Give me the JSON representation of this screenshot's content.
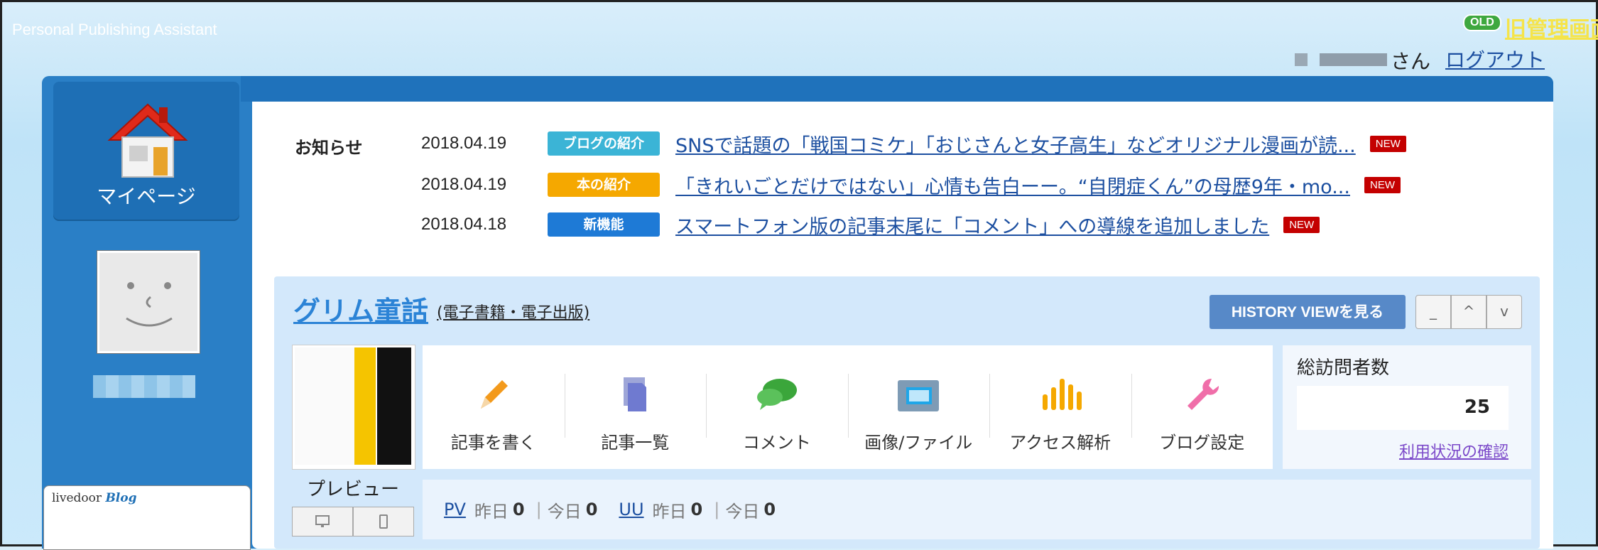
{
  "header": {
    "app_title": "Personal Publishing Assistant",
    "old_badge": "OLD",
    "old_admin_link": "旧管理画面",
    "user_suffix": "さん",
    "logout": "ログアウト"
  },
  "sidebar": {
    "mypage_label": "マイページ",
    "widget_logo": "livedoor",
    "widget_logo_accent": "Blog"
  },
  "news": {
    "heading": "お知らせ",
    "items": [
      {
        "date": "2018.04.19",
        "tag": "ブログの紹介",
        "tag_color": "#3bb4d6",
        "title": "SNSで話題の「戦国コミケ」「おじさんと女子高生」などオリジナル漫画が読...",
        "badge": "NEW"
      },
      {
        "date": "2018.04.19",
        "tag": "本の紹介",
        "tag_color": "#f5a800",
        "title": "「きれいごとだけではない」心情も告白ーー。“自閉症くん”の母歴9年・mo...",
        "badge": "NEW"
      },
      {
        "date": "2018.04.18",
        "tag": "新機能",
        "tag_color": "#1e7ad6",
        "title": "スマートフォン版の記事末尾に「コメント」への導線を追加しました",
        "badge": "NEW"
      }
    ]
  },
  "blog": {
    "title": "グリム童話",
    "category": "(電子書籍・電子出版)",
    "history_button": "HISTORY VIEWを見る",
    "controls": {
      "minimize": "_",
      "up": "^",
      "down": "v"
    },
    "preview_label": "プレビュー",
    "tools": [
      {
        "label": "記事を書く",
        "icon": "pencil-icon"
      },
      {
        "label": "記事一覧",
        "icon": "document-list-icon"
      },
      {
        "label": "コメント",
        "icon": "comment-bubble-icon"
      },
      {
        "label": "画像/ファイル",
        "icon": "image-folder-icon"
      },
      {
        "label": "アクセス解析",
        "icon": "bar-chart-icon"
      },
      {
        "label": "ブログ設定",
        "icon": "wrench-icon"
      }
    ],
    "visitors": {
      "title": "総訪問者数",
      "value": "25",
      "link": "利用状況の確認"
    },
    "stats": {
      "pv_label": "PV",
      "pv_yesterday_label": "昨日",
      "pv_yesterday": "0",
      "pv_today_label": "今日",
      "pv_today": "0",
      "uu_label": "UU",
      "uu_yesterday_label": "昨日",
      "uu_yesterday": "0",
      "uu_today_label": "今日",
      "uu_today": "0"
    }
  },
  "colors": {
    "accent": "#2a7fc6",
    "link": "#1c4fa0",
    "new_badge": "#c40000"
  }
}
